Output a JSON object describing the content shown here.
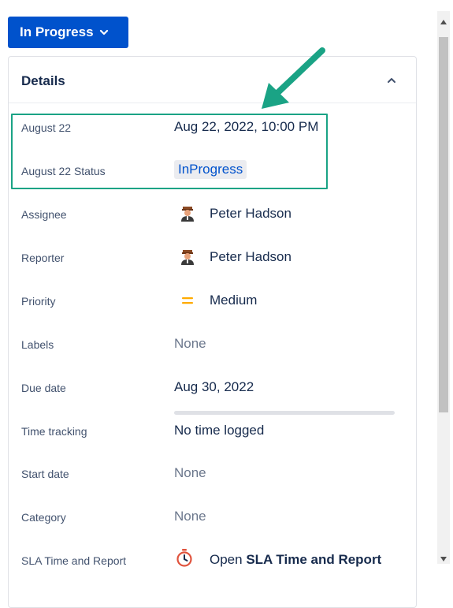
{
  "status_button": {
    "label": "In Progress",
    "icon": "chevron-down-icon"
  },
  "details": {
    "title": "Details",
    "collapse_icon": "chevron-up-icon",
    "rows": [
      {
        "label": "August 22",
        "value": "Aug 22, 2022, 10:00 PM"
      },
      {
        "label": "August 22 Status",
        "value": "InProgress"
      },
      {
        "label": "Assignee",
        "value": "Peter Hadson",
        "icon": "avatar"
      },
      {
        "label": "Reporter",
        "value": "Peter Hadson",
        "icon": "avatar"
      },
      {
        "label": "Priority",
        "value": "Medium",
        "icon": "priority-medium-icon"
      },
      {
        "label": "Labels",
        "value": "None"
      },
      {
        "label": "Due date",
        "value": "Aug 30, 2022"
      },
      {
        "label": "Time tracking",
        "value": "No time logged",
        "progress": 0
      },
      {
        "label": "Start date",
        "value": "None"
      },
      {
        "label": "Category",
        "value": "None"
      },
      {
        "label": "SLA Time and Report",
        "value_prefix": "Open ",
        "value_link": "SLA Time and Report",
        "icon": "stopwatch-icon"
      }
    ]
  },
  "colors": {
    "primary": "#0052cc",
    "annotation": "#1aa385",
    "priority_medium": "#ffab00"
  }
}
